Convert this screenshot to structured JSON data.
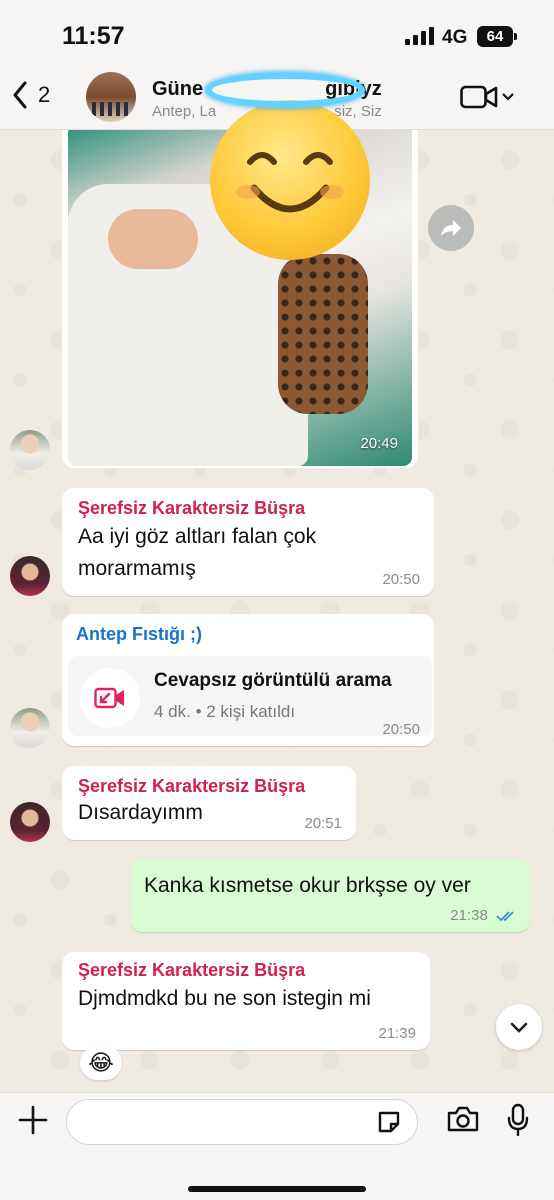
{
  "status_bar": {
    "time": "11:57",
    "network": "4G",
    "battery": "64"
  },
  "header": {
    "back_count": "2",
    "title": "Güne",
    "title_suffix": "gibiyz",
    "subtitle_start": "Antep, La",
    "subtitle_end": "siz, Siz"
  },
  "messages": {
    "photo": {
      "time": "20:49"
    },
    "m1": {
      "sender": "Şerefsiz Karaktersiz Büşra",
      "text_line1": "Aa iyi göz altları falan çok",
      "text_line2": "morarmamış",
      "time": "20:50"
    },
    "m2": {
      "sender": "Antep Fıstığı ;)",
      "call_title": "Cevapsız görüntülü arama",
      "call_meta": "4 dk. • 2 kişi katıldı",
      "time": "20:50"
    },
    "m3": {
      "sender": "Şerefsiz Karaktersiz Büşra",
      "text": "Dısardayımm",
      "time": "20:51"
    },
    "m4": {
      "text": "Kanka kısmetse okur brkşse oy ver",
      "time": "21:38"
    },
    "m5": {
      "sender": "Şerefsiz Karaktersiz Büşra",
      "text": "Djmdmdkd bu ne son istegin mi",
      "time": "21:39",
      "reaction": "😂"
    }
  },
  "input": {
    "placeholder": ""
  },
  "colors": {
    "sender_red": "#d1214f",
    "sender_blue": "#1b73c9",
    "outgoing_bubble": "#d9fdd3",
    "read_ticks": "#3e8ee0",
    "missed_call": "#e0245e"
  }
}
